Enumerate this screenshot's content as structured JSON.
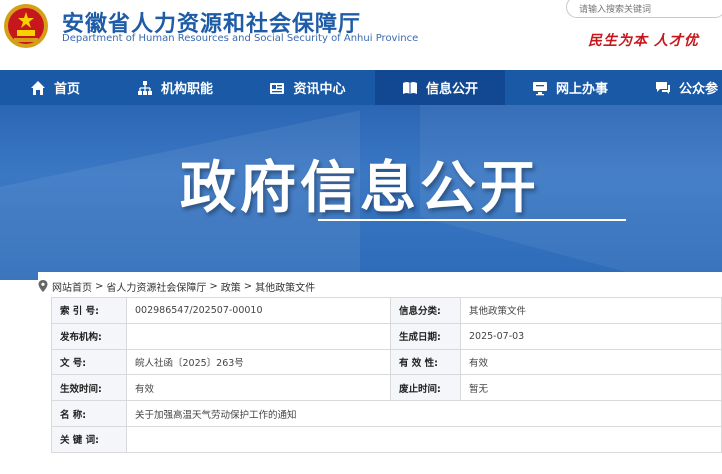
{
  "header": {
    "title": "安徽省人力资源和社会保障厅",
    "subtitle": "Department of Human Resources and Social Security of Anhui Province",
    "search_placeholder": "请输入搜索关键词",
    "slogan": "民生为本  人才优",
    "accent_color": "#1a59a6"
  },
  "nav": {
    "items": [
      {
        "label": "首页",
        "icon": "home-icon"
      },
      {
        "label": "机构职能",
        "icon": "org-chart-icon"
      },
      {
        "label": "资讯中心",
        "icon": "news-icon"
      },
      {
        "label": "信息公开",
        "icon": "book-icon",
        "active": true
      },
      {
        "label": "网上办事",
        "icon": "monitor-icon"
      },
      {
        "label": "公众参",
        "icon": "chat-icon"
      }
    ]
  },
  "banner": {
    "title": "政府信息公开"
  },
  "breadcrumb": [
    "网站首页",
    "省人力资源社会保障厅",
    "政策",
    "其他政策文件"
  ],
  "info": {
    "rows": [
      {
        "l1": "索 引 号:",
        "v1": "002986547/202507-00010",
        "l2": "信息分类:",
        "v2": "其他政策文件"
      },
      {
        "l1": "发布机构:",
        "v1": "",
        "l2": "生成日期:",
        "v2": "2025-07-03"
      },
      {
        "l1": "文    号:",
        "v1": "皖人社函〔2025〕263号",
        "l2": "有 效 性:",
        "v2": "有效"
      },
      {
        "l1": "生效时间:",
        "v1": "有效",
        "l2": "废止时间:",
        "v2": "暂无"
      }
    ],
    "name_label": "名    称:",
    "name_value": "关于加强高温天气劳动保护工作的通知",
    "keywords_label": "关 键 词:",
    "keywords_value": ""
  }
}
